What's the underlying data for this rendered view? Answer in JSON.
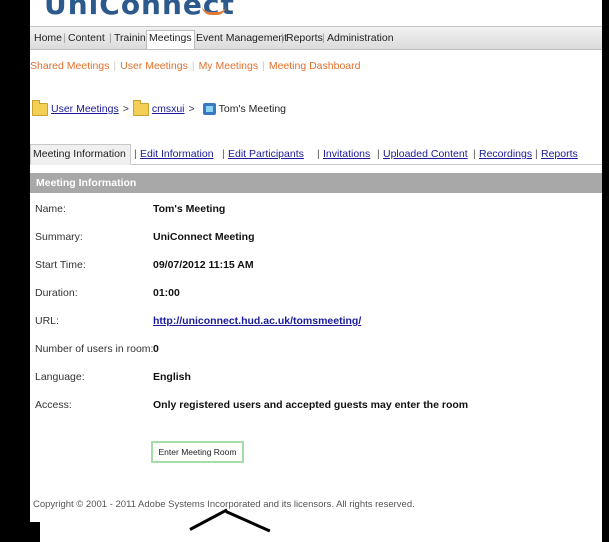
{
  "app": {
    "logo_text": "UniConnect"
  },
  "top_nav": {
    "items": [
      {
        "label": "Home"
      },
      {
        "label": "Content"
      },
      {
        "label": "Training"
      },
      {
        "label": "Meetings"
      },
      {
        "label": "Event Management"
      },
      {
        "label": "Reports"
      },
      {
        "label": "Administration"
      }
    ],
    "active": "Meetings"
  },
  "sub_nav": {
    "items": [
      {
        "label": "Shared Meetings"
      },
      {
        "label": "User Meetings"
      },
      {
        "label": "My Meetings"
      },
      {
        "label": "Meeting Dashboard"
      }
    ]
  },
  "breadcrumb": {
    "items": [
      {
        "label": "User Meetings",
        "icon": "folder-icon"
      },
      {
        "label": "cmsxui",
        "icon": "folder-icon"
      },
      {
        "label": "Tom's Meeting",
        "icon": "meeting-icon"
      }
    ],
    "separator": ">"
  },
  "tabs": {
    "active": "Meeting Information",
    "links": [
      "Edit Information",
      "Edit Participants",
      "Invitations",
      "Uploaded Content",
      "Recordings",
      "Reports"
    ],
    "separator": "|"
  },
  "section": {
    "title": "Meeting Information",
    "header_color": "#a8a8a8",
    "fields": [
      {
        "label": "Name:",
        "value": "Tom's Meeting"
      },
      {
        "label": "Summary:",
        "value": "UniConnect Meeting"
      },
      {
        "label": "Start Time:",
        "value": "09/07/2012 11:15 AM"
      },
      {
        "label": "Duration:",
        "value": "01:00"
      },
      {
        "label": "URL:",
        "value": "http://uniconnect.hud.ac.uk/tomsmeeting/"
      },
      {
        "label": "Number of users in room:",
        "value": "0"
      },
      {
        "label": "Language:",
        "value": "English"
      },
      {
        "label": "Access:",
        "value": "Only registered users and accepted guests may enter the room"
      }
    ]
  },
  "enter_button": {
    "label": "Enter Meeting Room"
  },
  "footer": {
    "copyright": "Copyright © 2001 - 2011 Adobe Systems Incorporated and its licensors. All rights reserved."
  },
  "colors": {
    "accent_orange": "#e0702c",
    "link_blue": "#1a1a9a",
    "button_border": "#a6dca6"
  }
}
